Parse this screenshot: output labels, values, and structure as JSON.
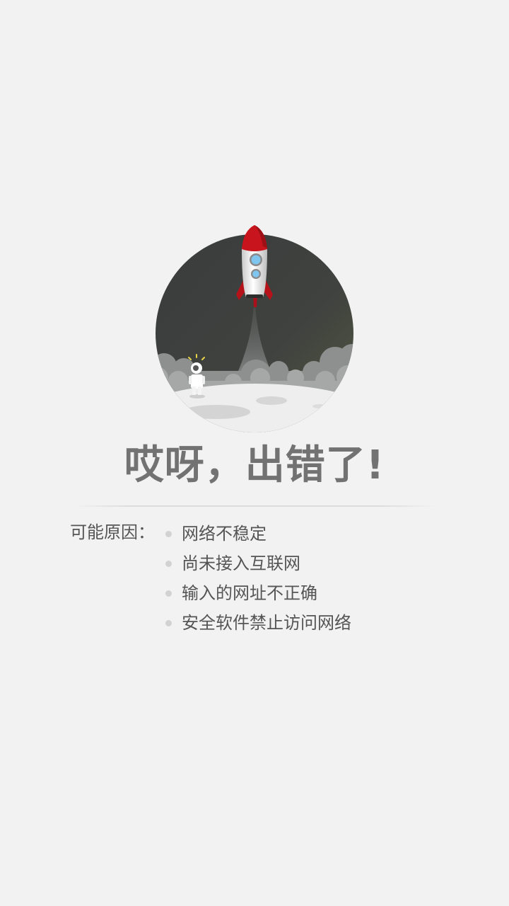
{
  "error": {
    "title": "哎呀，出错了!",
    "reasons_label": "可能原因：",
    "reasons": [
      "网络不稳定",
      "尚未接入互联网",
      "输入的网址不正确",
      "安全软件禁止访问网络"
    ]
  },
  "colors": {
    "background": "#f2f2f2",
    "title": "#727272",
    "text": "#555555",
    "bullet": "#d2d2d2",
    "rocket_red": "#c8141c",
    "sky": "#3e4140"
  },
  "illustration": {
    "subject": "rocket-launching-from-moon-with-astronaut-icon"
  }
}
